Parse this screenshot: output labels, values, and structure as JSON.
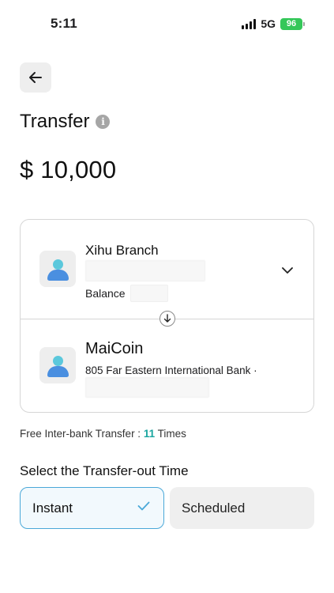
{
  "status_bar": {
    "time": "5:11",
    "network": "5G",
    "battery": "96"
  },
  "header": {
    "back_icon": "arrow-left-icon",
    "title": "Transfer",
    "info_icon": "i"
  },
  "amount": {
    "currency": "$",
    "value": "10,000"
  },
  "from_account": {
    "name": "Xihu Branch",
    "balance_label": "Balance"
  },
  "to_account": {
    "name": "MaiCoin",
    "bank": "805 Far Eastern International Bank ·"
  },
  "free_transfer": {
    "label": "Free Inter-bank Transfer :",
    "count": "11",
    "unit": "Times"
  },
  "transfer_time": {
    "label": "Select the Transfer-out Time",
    "options": [
      "Instant",
      "Scheduled"
    ],
    "selected": "Instant"
  },
  "colors": {
    "accent": "#4aa8d8",
    "count_highlight": "#1aa6a0",
    "battery": "#34c759"
  }
}
